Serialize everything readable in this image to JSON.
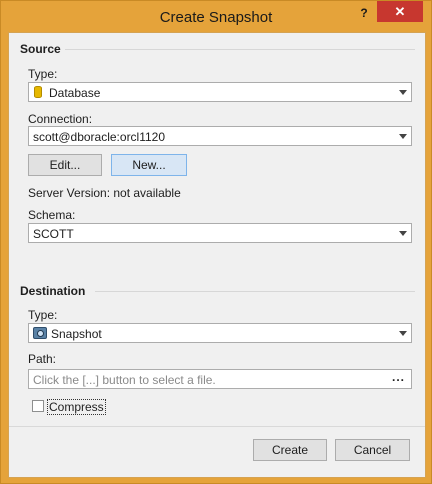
{
  "window": {
    "title": "Create Snapshot",
    "help": "?",
    "close": "✕"
  },
  "source": {
    "heading": "Source",
    "type_label": "Type:",
    "type_value": "Database",
    "connection_label": "Connection:",
    "connection_value": "scott@dboracle:orcl1120",
    "edit_button": "Edit...",
    "new_button": "New...",
    "server_version": "Server Version: not available",
    "schema_label": "Schema:",
    "schema_value": "SCOTT"
  },
  "destination": {
    "heading": "Destination",
    "type_label": "Type:",
    "type_value": "Snapshot",
    "path_label": "Path:",
    "path_placeholder": "Click the [...] button to select a file.",
    "browse_button": "...",
    "compress_label": "Compress",
    "compress_checked": false
  },
  "footer": {
    "create_button": "Create",
    "cancel_button": "Cancel"
  },
  "colors": {
    "frame": "#e5a33a",
    "close": "#c7372f",
    "active_button": "#d8e6f5"
  },
  "icons": {
    "database": "database-icon",
    "snapshot": "camera-icon",
    "help": "help-icon",
    "close": "close-icon",
    "dropdown": "chevron-down-icon"
  }
}
